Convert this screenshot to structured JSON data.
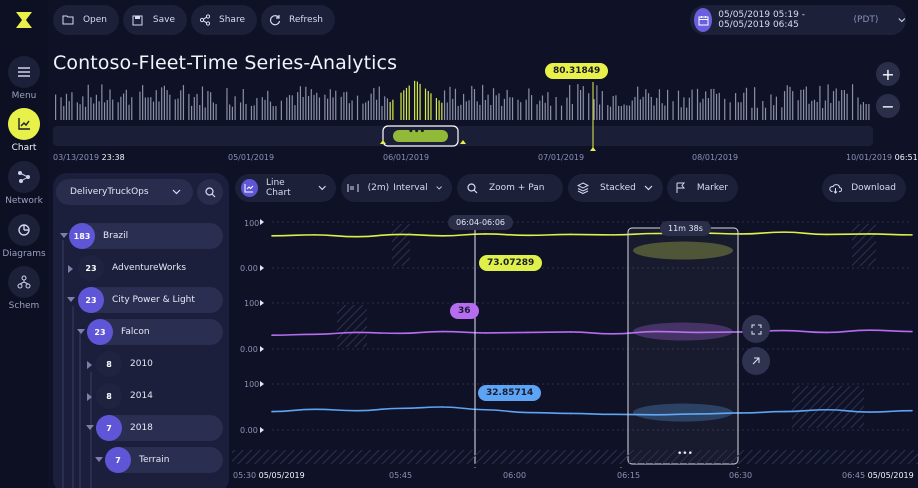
{
  "app": {
    "title": "Contoso-Fleet-Time Series-Analytics"
  },
  "rail": [
    {
      "label": "Menu",
      "icon": "menu-icon"
    },
    {
      "label": "Chart",
      "icon": "chart-icon",
      "active": true
    },
    {
      "label": "Network",
      "icon": "network-icon"
    },
    {
      "label": "Diagrams",
      "icon": "diagram-icon"
    },
    {
      "label": "Schem",
      "icon": "schema-icon"
    }
  ],
  "toolbar": {
    "open": "Open",
    "save": "Save",
    "share": "Share",
    "refresh": "Refresh"
  },
  "daterange": {
    "text": "05/05/2019 05:19 - 05/05/2019 06:45",
    "tz": "(PDT)"
  },
  "overview": {
    "start_date": "03/13/2019",
    "start_time": "23:38",
    "ticks": [
      "05/01/2019",
      "06/01/2019",
      "07/01/2019",
      "08/01/2019"
    ],
    "end_date": "10/01/2019",
    "end_time": "06:51",
    "marker_value": "80.31849",
    "handle": "•••"
  },
  "tree": {
    "root": "DeliveryTruckOps",
    "nodes": [
      {
        "count": "183",
        "label": "Brazil"
      },
      {
        "count": "23",
        "label": "AdventureWorks"
      },
      {
        "count": "23",
        "label": "City Power & Light"
      },
      {
        "count": "23",
        "label": "Falcon"
      },
      {
        "count": "8",
        "label": "2010"
      },
      {
        "count": "8",
        "label": "2014"
      },
      {
        "count": "7",
        "label": "2018"
      },
      {
        "count": "7",
        "label": "Terrain"
      }
    ]
  },
  "chart_toolbar": {
    "chart_type": "Line Chart",
    "interval_value": "(2m)",
    "interval": "Interval",
    "zoom": "Zoom + Pan",
    "stacked": "Stacked",
    "marker": "Marker",
    "download": "Download"
  },
  "chart": {
    "cursor_label": "06:04-06:06",
    "brush_label": "11m 38s",
    "brush_handle": "•••",
    "y_max": "100",
    "y_min": "0.00",
    "cursor_values": [
      "73.07289",
      "36",
      "32.85714"
    ],
    "x_start_time": "05:30",
    "x_start_date": "05/05/2019",
    "x_ticks": [
      "05:45",
      "06:00",
      "06:15",
      "06:30"
    ],
    "x_end_time": "06:45",
    "x_end_date": "05/05/2019"
  },
  "chart_data": {
    "type": "line",
    "x": [
      "05:30",
      "05:35",
      "05:40",
      "05:45",
      "05:50",
      "05:55",
      "06:00",
      "06:05",
      "06:10",
      "06:15",
      "06:20",
      "06:25",
      "06:30",
      "06:35",
      "06:40",
      "06:45"
    ],
    "ylim": [
      0,
      100
    ],
    "series": [
      {
        "values": [
          70,
          72,
          68,
          73,
          70,
          74,
          71,
          73,
          72,
          75,
          76,
          74,
          78,
          73,
          74,
          72
        ],
        "color": "#dff04a"
      },
      {
        "values": [
          30,
          32,
          36,
          34,
          38,
          35,
          36,
          37,
          33,
          38,
          36,
          37,
          40,
          36,
          41,
          38
        ],
        "color": "#b66cf0"
      },
      {
        "values": [
          40,
          45,
          42,
          47,
          50,
          44,
          38,
          36,
          34,
          33,
          35,
          37,
          40,
          44,
          39,
          42
        ],
        "color": "#5ea4f5"
      }
    ]
  },
  "colors": {
    "accent": "#e8f04a",
    "purple": "#b66cf0",
    "blue": "#5ea4f5",
    "badge": "#5e56d6"
  }
}
